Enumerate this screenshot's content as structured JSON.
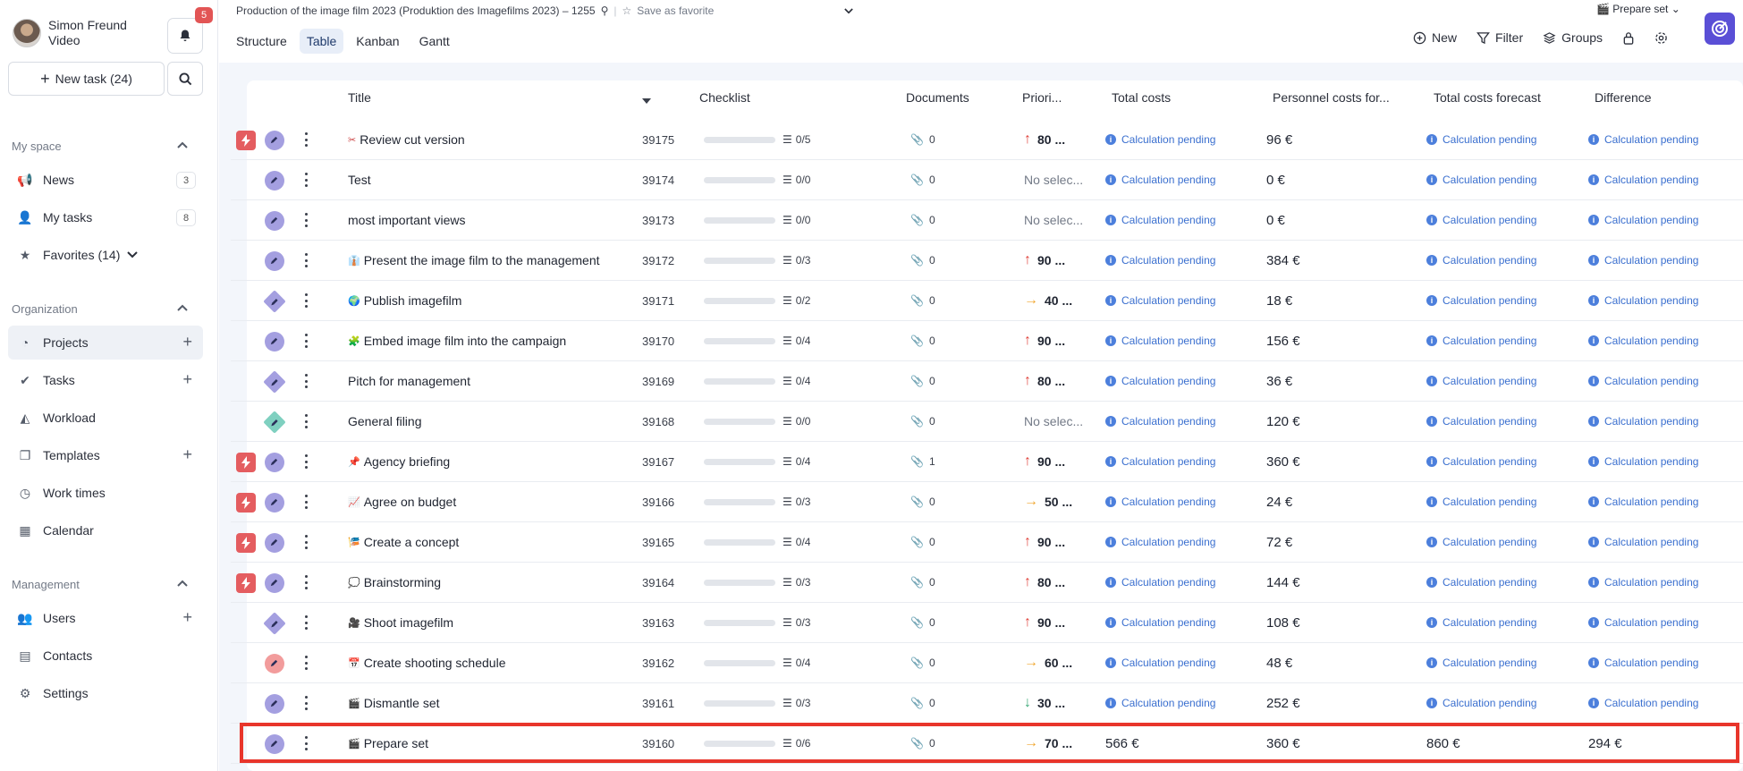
{
  "user": {
    "name": "Simon Freund",
    "role": "Video",
    "notifications": "5"
  },
  "sidebar": {
    "new_task": "New task (24)",
    "sections": [
      {
        "title": "My space",
        "items": [
          {
            "label": "News",
            "count": "3",
            "icon": "megaphone-icon"
          },
          {
            "label": "My tasks",
            "count": "8",
            "icon": "person-icon"
          },
          {
            "label": "Favorites (14)",
            "icon": "star-icon"
          }
        ]
      },
      {
        "title": "Organization",
        "items": [
          {
            "label": "Projects",
            "icon": "pie-icon",
            "active": true
          },
          {
            "label": "Tasks",
            "icon": "check-circle-icon"
          },
          {
            "label": "Workload",
            "icon": "area-chart-icon"
          },
          {
            "label": "Templates",
            "icon": "copy-icon"
          },
          {
            "label": "Work times",
            "icon": "clock-icon"
          },
          {
            "label": "Calendar",
            "icon": "calendar-icon"
          }
        ]
      },
      {
        "title": "Management",
        "items": [
          {
            "label": "Users",
            "icon": "users-icon"
          },
          {
            "label": "Contacts",
            "icon": "contact-icon"
          },
          {
            "label": "Settings",
            "icon": "gear-icon"
          }
        ]
      }
    ]
  },
  "header": {
    "breadcrumb": "Production of the image film 2023 (Produktion des Imagefilms 2023) – 1255",
    "save_favorite": "Save as favorite",
    "view_selector": "Prepare set",
    "tabs": [
      "Structure",
      "Table",
      "Kanban",
      "Gantt"
    ],
    "toolbar": {
      "new": "New",
      "filter": "Filter",
      "groups": "Groups"
    }
  },
  "table": {
    "columns": {
      "title": "Title",
      "checklist": "Checklist",
      "documents": "Documents",
      "priority": "Priori...",
      "total_costs": "Total costs",
      "personnel": "Personnel costs for...",
      "forecast": "Total costs forecast",
      "difference": "Difference"
    },
    "calc_pending": "Calculation pending",
    "rows": [
      {
        "urgent": true,
        "type": "circle",
        "emoji": "✂",
        "title": "Review cut version",
        "id": "39175",
        "check": "0/5",
        "docs": "0",
        "prio": "80 ...",
        "prio_dir": "up",
        "total": "",
        "personnel": "96 €",
        "forecast": "",
        "diff": ""
      },
      {
        "urgent": false,
        "type": "circle",
        "emoji": "",
        "title": "Test",
        "id": "39174",
        "check": "0/0",
        "docs": "0",
        "prio": "No selec...",
        "prio_dir": "none",
        "total": "",
        "personnel": "0 €",
        "forecast": "",
        "diff": ""
      },
      {
        "urgent": false,
        "type": "circle",
        "emoji": "",
        "title": "most important views",
        "id": "39173",
        "check": "0/0",
        "docs": "0",
        "prio": "No selec...",
        "prio_dir": "none",
        "total": "",
        "personnel": "0 €",
        "forecast": "",
        "diff": ""
      },
      {
        "urgent": false,
        "type": "circle",
        "emoji": "👔",
        "title": "Present the image film to the management",
        "id": "39172",
        "check": "0/3",
        "docs": "0",
        "prio": "90 ...",
        "prio_dir": "up",
        "total": "",
        "personnel": "384 €",
        "forecast": "",
        "diff": ""
      },
      {
        "urgent": false,
        "type": "diamond",
        "emoji": "🌍",
        "title": "Publish imagefilm",
        "id": "39171",
        "check": "0/2",
        "docs": "0",
        "prio": "40 ...",
        "prio_dir": "right",
        "total": "",
        "personnel": "18 €",
        "forecast": "",
        "diff": ""
      },
      {
        "urgent": false,
        "type": "circle",
        "emoji": "🧩",
        "title": "Embed image film into the campaign",
        "id": "39170",
        "check": "0/4",
        "docs": "0",
        "prio": "90 ...",
        "prio_dir": "up",
        "total": "",
        "personnel": "156 €",
        "forecast": "",
        "diff": ""
      },
      {
        "urgent": false,
        "type": "diamond",
        "emoji": "",
        "title": "Pitch for management",
        "id": "39169",
        "check": "0/4",
        "docs": "0",
        "prio": "80 ...",
        "prio_dir": "up",
        "total": "",
        "personnel": "36 €",
        "forecast": "",
        "diff": ""
      },
      {
        "urgent": false,
        "type": "diamond-teal",
        "emoji": "",
        "title": "General filing",
        "id": "39168",
        "check": "0/0",
        "docs": "0",
        "prio": "No selec...",
        "prio_dir": "none",
        "total": "",
        "personnel": "120 €",
        "forecast": "",
        "diff": ""
      },
      {
        "urgent": true,
        "type": "circle",
        "emoji": "📌",
        "title": "Agency briefing",
        "id": "39167",
        "check": "0/4",
        "docs": "1",
        "prio": "90 ...",
        "prio_dir": "up",
        "total": "",
        "personnel": "360 €",
        "forecast": "",
        "diff": ""
      },
      {
        "urgent": true,
        "type": "circle",
        "emoji": "📈",
        "title": "Agree on budget",
        "id": "39166",
        "check": "0/3",
        "docs": "0",
        "prio": "50 ...",
        "prio_dir": "right",
        "total": "",
        "personnel": "24 €",
        "forecast": "",
        "diff": ""
      },
      {
        "urgent": true,
        "type": "circle",
        "emoji": "🎏",
        "title": "Create a concept",
        "id": "39165",
        "check": "0/4",
        "docs": "0",
        "prio": "90 ...",
        "prio_dir": "up",
        "total": "",
        "personnel": "72 €",
        "forecast": "",
        "diff": ""
      },
      {
        "urgent": true,
        "type": "circle",
        "emoji": "💭",
        "title": "Brainstorming",
        "id": "39164",
        "check": "0/3",
        "docs": "0",
        "prio": "80 ...",
        "prio_dir": "up",
        "total": "",
        "personnel": "144 €",
        "forecast": "",
        "diff": ""
      },
      {
        "urgent": false,
        "type": "diamond",
        "emoji": "🎥",
        "title": "Shoot imagefilm",
        "id": "39163",
        "check": "0/3",
        "docs": "0",
        "prio": "90 ...",
        "prio_dir": "up",
        "total": "",
        "personnel": "108 €",
        "forecast": "",
        "diff": ""
      },
      {
        "urgent": false,
        "type": "circle-red",
        "emoji": "📅",
        "title": "Create shooting schedule",
        "id": "39162",
        "check": "0/4",
        "docs": "0",
        "prio": "60 ...",
        "prio_dir": "right",
        "total": "",
        "personnel": "48 €",
        "forecast": "",
        "diff": ""
      },
      {
        "urgent": false,
        "type": "circle",
        "emoji": "🎬",
        "title": "Dismantle set",
        "id": "39161",
        "check": "0/3",
        "docs": "0",
        "prio": "30 ...",
        "prio_dir": "down",
        "total": "",
        "personnel": "252 €",
        "forecast": "",
        "diff": ""
      },
      {
        "urgent": false,
        "type": "circle",
        "emoji": "🎬",
        "title": "Prepare set",
        "id": "39160",
        "check": "0/6",
        "docs": "0",
        "prio": "70 ...",
        "prio_dir": "right",
        "total": "566 €",
        "personnel": "360 €",
        "forecast": "860 €",
        "diff": "294 €"
      }
    ]
  },
  "colors": {
    "accent": "#5a4fd6",
    "highlight": "#e8352b",
    "urgent": "#e45d60",
    "link": "#3a6fcf"
  }
}
